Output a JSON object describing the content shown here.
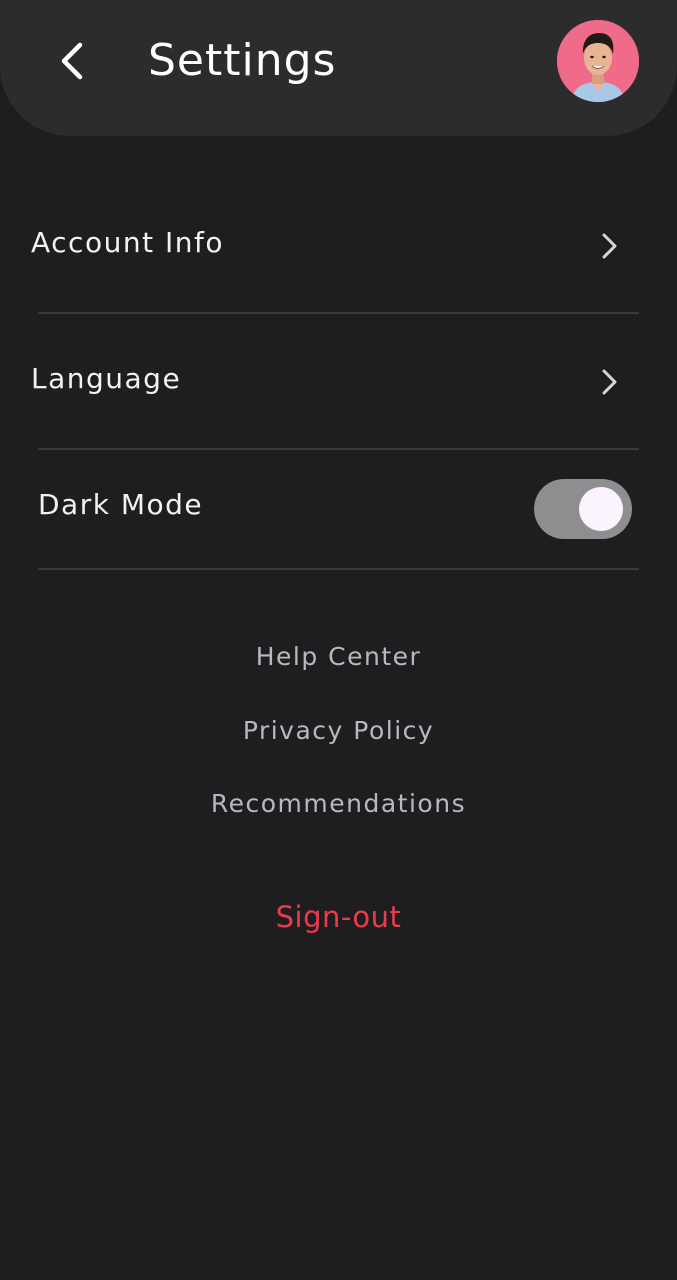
{
  "header": {
    "back_icon": "chevron-left-icon",
    "title": "Settings",
    "avatar_bg": "#f06a8a"
  },
  "settings": {
    "items": [
      {
        "label": "Account Info",
        "icon": "chevron-right-icon"
      },
      {
        "label": "Language",
        "icon": "chevron-right-icon"
      },
      {
        "label": "Dark Mode",
        "toggle_on": true
      }
    ]
  },
  "links": [
    {
      "label": "Help Center"
    },
    {
      "label": "Privacy Policy"
    },
    {
      "label": "Recommendations"
    }
  ],
  "signout": {
    "label": "Sign-out",
    "color": "#ec3b4a"
  },
  "theme": {
    "background": "#1e1e20",
    "header_bg": "#2c2c2e",
    "toggle_track": "#8e8e91",
    "toggle_knob": "#fbf4ff"
  }
}
